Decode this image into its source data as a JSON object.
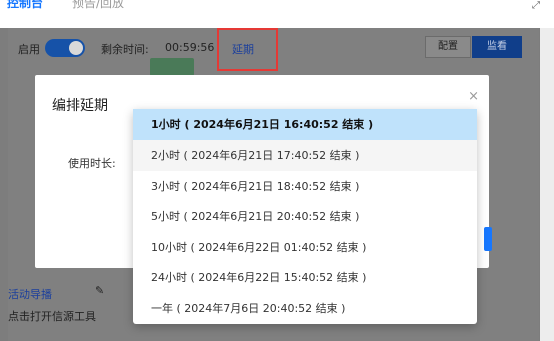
{
  "tabs": [
    {
      "label": "控制台"
    },
    {
      "label": "预告/回放"
    }
  ],
  "expand_icon": "expand-icon",
  "toolbar": {
    "enable_label": "启用",
    "remaining_label": "剩余时间:",
    "remaining_time": "00:59:56",
    "extend_label": "延期",
    "config_button": "配置",
    "monitor_button": "监看"
  },
  "modal": {
    "title": "编排延期",
    "duration_label": "使用时长:",
    "close_icon": "close-icon"
  },
  "footer": {
    "live_guide": "活动导播",
    "click_open": "点击打开信源工具"
  },
  "dropdown": {
    "options": [
      {
        "label": "1小时 ( 2024年6月21日 16:40:52 结束 )"
      },
      {
        "label": "2小时 ( 2024年6月21日 17:40:52 结束 )"
      },
      {
        "label": "3小时 ( 2024年6月21日 18:40:52 结束 )"
      },
      {
        "label": "5小时 ( 2024年6月21日 20:40:52 结束 )"
      },
      {
        "label": "10小时 ( 2024年6月22日 01:40:52 结束 )"
      },
      {
        "label": "24小时 ( 2024年6月22日 15:40:52 结束 )"
      },
      {
        "label": "一年 ( 2024年7月6日 20:40:52 结束 )"
      }
    ],
    "selected_index": 0
  },
  "colors": {
    "accent": "#1677ff",
    "selected_bg": "#bfe2fb",
    "highlight_border": "#e53935"
  }
}
